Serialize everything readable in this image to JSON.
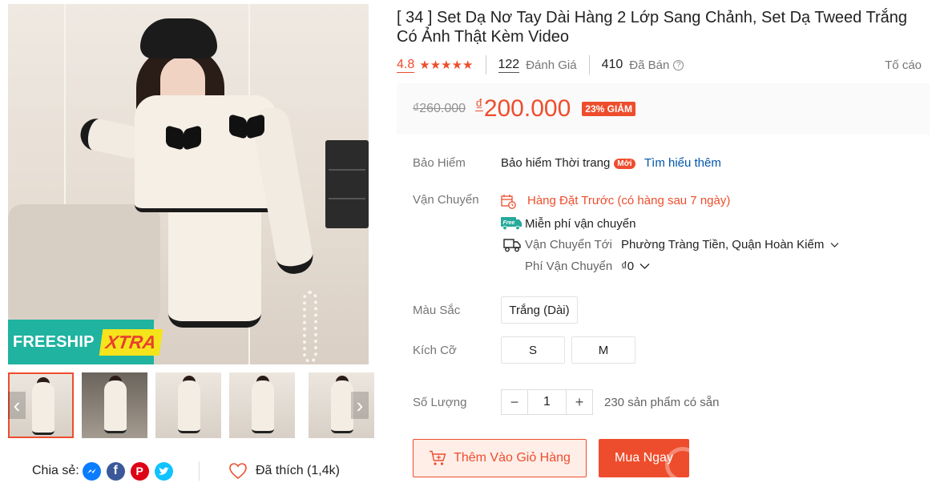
{
  "gallery": {
    "freeship_text": "FREESHIP",
    "freeship_xtra": "XTRA"
  },
  "share": {
    "label": "Chia sẻ:",
    "liked": "Đã thích (1,4k)"
  },
  "product": {
    "title": "[ 34 ] Set Dạ Nơ Tay Dài Hàng 2 Lớp Sang Chảnh, Set Dạ Tweed Trắng Có Ảnh Thật Kèm Video",
    "rating": "4.8",
    "stars": "★★★★★",
    "reviews_count": "122",
    "reviews_label": "Đánh Giá",
    "sold_count": "410",
    "sold_label": "Đã Bán",
    "report": "Tố cáo"
  },
  "price": {
    "original": "₫260.000",
    "currency": "₫",
    "current": "200.000",
    "discount": "23% GIẢM"
  },
  "insurance": {
    "label": "Bảo Hiểm",
    "value": "Bảo hiểm Thời trang",
    "badge": "Mới",
    "link": "Tìm hiểu thêm"
  },
  "shipping": {
    "label": "Vận Chuyển",
    "preorder": "Hàng Đặt Trước (có hàng sau 7 ngày)",
    "free_badge": "Free",
    "free_text": "Miễn phí vận chuyển",
    "to_label": "Vận Chuyển Tới",
    "to_value": "Phường Tràng Tiền, Quận Hoàn Kiếm",
    "fee_label": "Phí Vận Chuyển",
    "fee_value": "₫0"
  },
  "color": {
    "label": "Màu Sắc",
    "options": [
      "Trắng (Dài)"
    ]
  },
  "size": {
    "label": "Kích Cỡ",
    "options": [
      "S",
      "M"
    ]
  },
  "quantity": {
    "label": "Số Lượng",
    "minus": "−",
    "value": "1",
    "plus": "+",
    "stock": "230 sản phẩm có sẵn"
  },
  "actions": {
    "add_to_cart": "Thêm Vào Giỏ Hàng",
    "buy_now": "Mua Ngay"
  },
  "colors": {
    "accent": "#ee4d2d",
    "link": "#0055aa",
    "freeship": "#1fb3a0"
  }
}
